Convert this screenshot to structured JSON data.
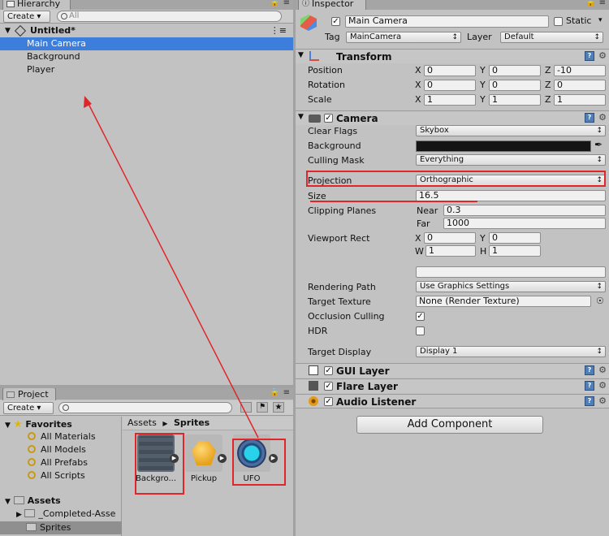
{
  "hierarchy": {
    "tab": "Hierarchy",
    "create": "Create",
    "search_placeholder": "All",
    "scene": "Untitled*",
    "items": [
      "Main Camera",
      "Background",
      "Player"
    ]
  },
  "project": {
    "tab": "Project",
    "create": "Create",
    "favorites_label": "Favorites",
    "favorites": [
      "All Materials",
      "All Models",
      "All Prefabs",
      "All Scripts"
    ],
    "assets_label": "Assets",
    "asset_folders": [
      "_Completed-Asse",
      "Sprites"
    ],
    "breadcrumb": [
      "Assets",
      "Sprites"
    ],
    "assets": [
      "Backgro...",
      "Pickup",
      "UFO"
    ]
  },
  "inspector": {
    "tab": "Inspector",
    "object_name": "Main Camera",
    "static_label": "Static",
    "tag_label": "Tag",
    "tag_value": "MainCamera",
    "layer_label": "Layer",
    "layer_value": "Default",
    "transform": {
      "title": "Transform",
      "rows": [
        {
          "label": "Position",
          "x": "0",
          "y": "0",
          "z": "-10"
        },
        {
          "label": "Rotation",
          "x": "0",
          "y": "0",
          "z": "0"
        },
        {
          "label": "Scale",
          "x": "1",
          "y": "1",
          "z": "1"
        }
      ],
      "axis": [
        "X",
        "Y",
        "Z"
      ]
    },
    "camera": {
      "title": "Camera",
      "clear_flags_label": "Clear Flags",
      "clear_flags": "Skybox",
      "background_label": "Background",
      "culling_mask_label": "Culling Mask",
      "culling_mask": "Everything",
      "projection_label": "Projection",
      "projection": "Orthographic",
      "size_label": "Size",
      "size": "16.5",
      "clipping_label": "Clipping Planes",
      "near_label": "Near",
      "near": "0.3",
      "far_label": "Far",
      "far": "1000",
      "viewport_label": "Viewport Rect",
      "vx": "0",
      "vy": "0",
      "vw": "1",
      "vh": "1",
      "x_label": "X",
      "y_label": "Y",
      "w_label": "W",
      "h_label": "H",
      "rendering_path_label": "Rendering Path",
      "rendering_path": "Use Graphics Settings",
      "target_texture_label": "Target Texture",
      "target_texture": "None (Render Texture)",
      "occlusion_label": "Occlusion Culling",
      "hdr_label": "HDR",
      "target_display_label": "Target Display",
      "target_display": "Display 1"
    },
    "components": [
      "GUI Layer",
      "Flare Layer",
      "Audio Listener"
    ],
    "add_component": "Add Component"
  },
  "colors": {
    "selection": "#3d7ddb",
    "annotation": "#e0262a"
  }
}
